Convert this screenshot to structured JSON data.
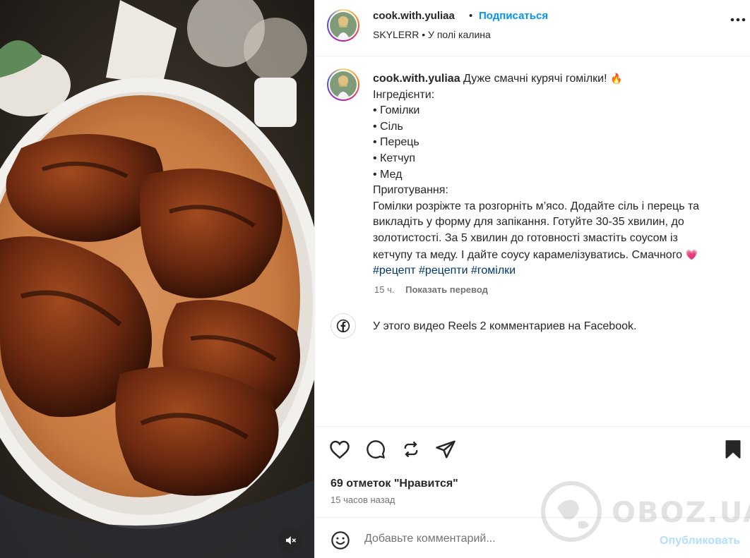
{
  "header": {
    "username": "cook.with.yuliaa",
    "separator": "•",
    "follow_label": "Подписаться",
    "audio": "SKYLERR • У полі калина",
    "more_icon": "more-horizontal-icon"
  },
  "caption": {
    "username": "cook.with.yuliaa",
    "first_line": "Дуже смачні курячі гомілки!",
    "first_emoji": "🔥",
    "lines": [
      "Інгредієнти:",
      "• Гомілки",
      "• Сіль",
      "• Перець",
      "• Кетчуп",
      "• Мед",
      "Приготування:",
      "Гомілки розріжте та розгорніть м’ясо. Додайте сіль і перець та",
      "викладіть у форму для запікання. Готуйте 30-35 хвилин, до",
      "золотистості. За 5 хвилин до готовності змастіть соусом із"
    ],
    "last_line": "кетчупу та меду. І дайте соусу карамелізуватись. Смачного",
    "last_emoji": "💗",
    "hashtags": [
      "#рецепт",
      "#рецепти",
      "#гомілки"
    ],
    "time": "15 ч.",
    "translate_label": "Показать перевод"
  },
  "facebook": {
    "icon": "facebook-icon",
    "text": "У этого видео Reels 2 комментариев на Facebook."
  },
  "actions": {
    "icons": [
      "heart-icon",
      "comment-icon",
      "repost-icon",
      "share-icon",
      "bookmark-icon"
    ],
    "likes": "69 отметок \"Нравится\"",
    "time_ago": "15 часов назад"
  },
  "comment": {
    "placeholder": "Добавьте комментарий...",
    "publish_label": "Опубликовать"
  },
  "media": {
    "mute_icon": "speaker-muted-icon"
  },
  "watermark": {
    "text": "OBOZ.UA"
  },
  "colors": {
    "accent_blue": "#0095f6",
    "publish_disabled": "#b2dffc",
    "hashtag": "#00376b",
    "secondary_text": "#737373"
  }
}
